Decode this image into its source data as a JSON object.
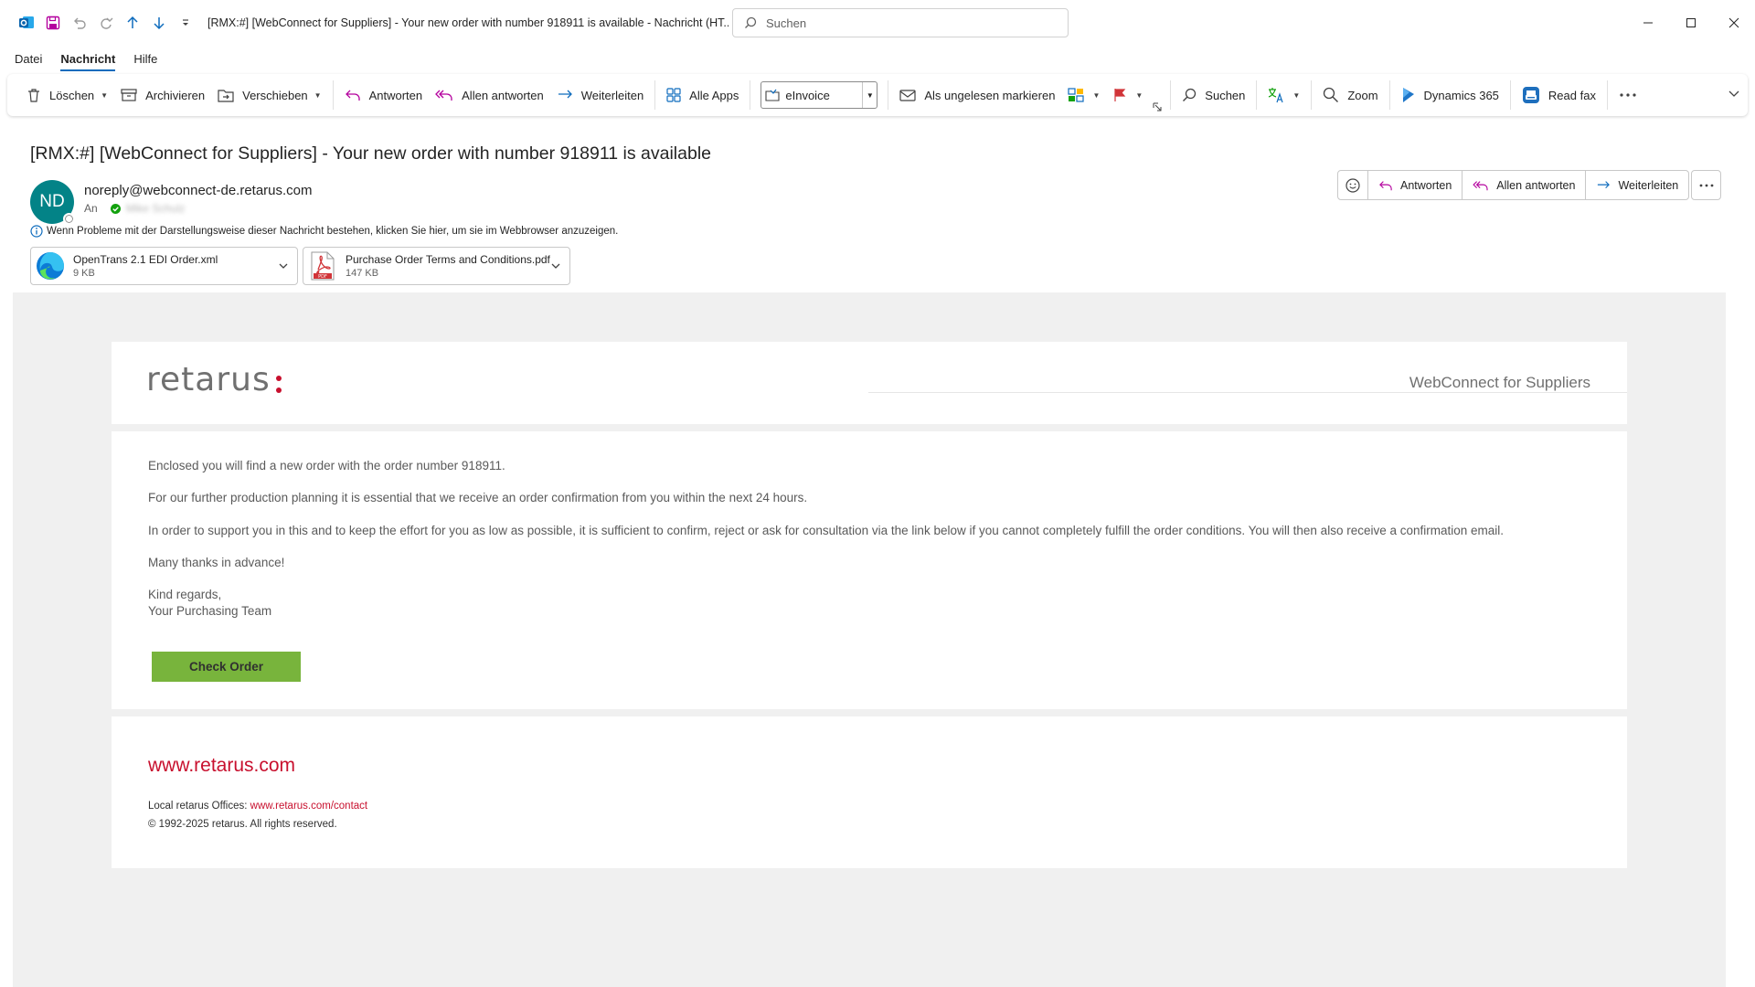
{
  "window": {
    "title": "[RMX:#] [WebConnect for Suppliers] - Your new order with number 918911 is available  -  Nachricht (HT...",
    "search_placeholder": "Suchen"
  },
  "menu": {
    "tabs": [
      {
        "label": "Datei",
        "active": false
      },
      {
        "label": "Nachricht",
        "active": true
      },
      {
        "label": "Hilfe",
        "active": false
      }
    ]
  },
  "ribbon": {
    "delete": "Löschen",
    "archive": "Archivieren",
    "move": "Verschieben",
    "reply": "Antworten",
    "reply_all": "Allen antworten",
    "forward": "Weiterleiten",
    "all_apps": "Alle Apps",
    "einvoice": "eInvoice",
    "mark_unread": "Als ungelesen markieren",
    "search": "Suchen",
    "zoom": "Zoom",
    "dynamics": "Dynamics 365",
    "read_fax": "Read fax"
  },
  "message": {
    "subject": "[RMX:#] [WebConnect for Suppliers] - Your new order with number 918911 is available",
    "avatar_initials": "ND",
    "sender": "noreply@webconnect-de.retarus.com",
    "to_label": "An",
    "recipient": "Mike Schulz",
    "info": "Wenn Probleme mit der Darstellungsweise dieser Nachricht bestehen, klicken Sie hier, um sie im Webbrowser anzuzeigen.",
    "actions": {
      "reply": "Antworten",
      "reply_all": "Allen antworten",
      "forward": "Weiterleiten"
    },
    "attachments": [
      {
        "name": "OpenTrans 2.1 EDI Order.xml",
        "size": "9 KB",
        "icon": "edge-icon"
      },
      {
        "name": "Purchase Order Terms and Conditions.pdf",
        "size": "147 KB",
        "icon": "pdf-icon"
      }
    ]
  },
  "email": {
    "logo_text": "retarus",
    "brand_title": "WebConnect for Suppliers",
    "paragraphs": [
      "Enclosed you will find a new order with the order number 918911.",
      "For our further production planning it is essential that we receive an order confirmation from you within the next 24 hours.",
      "In order to support you in this and to keep the effort for you as low as possible, it is sufficient to confirm, reject or ask for consultation via the link below if you cannot completely fulfill the order conditions. You will then also receive a confirmation email.",
      "Many thanks in advance!"
    ],
    "closing_1": "Kind regards,",
    "closing_2": "Your Purchasing Team",
    "button": "Check Order",
    "footer_link": "www.retarus.com",
    "offices_label": "Local retarus Offices: ",
    "offices_link": "www.retarus.com/contact",
    "copyright": "© 1992-2025 retarus. All rights reserved."
  },
  "colors": {
    "accent": "#0f6cbd",
    "avatar": "#038387",
    "brand_red": "#c8102e",
    "button_green": "#78b43c",
    "body_bg": "#f0f0f0"
  }
}
